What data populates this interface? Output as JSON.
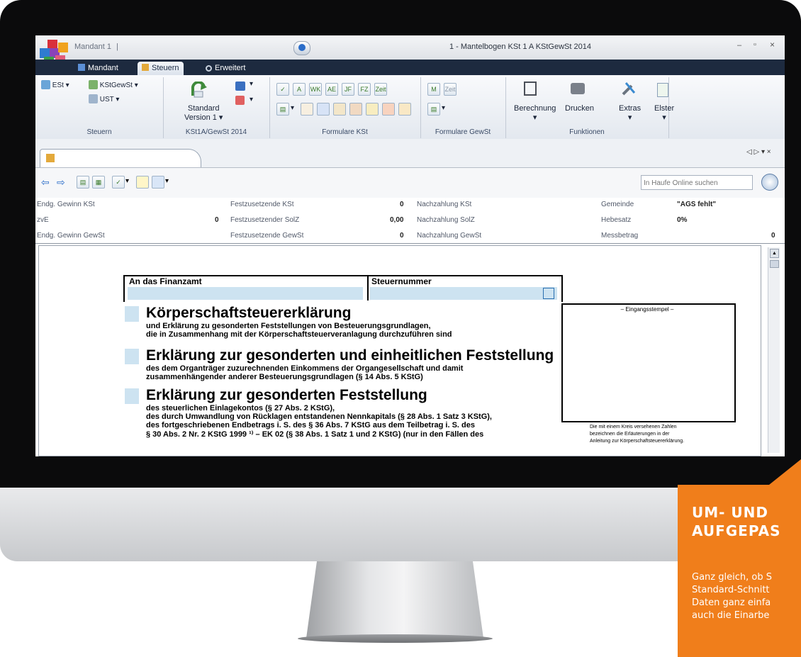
{
  "window": {
    "tab_label": "Mandant 1",
    "tab_separator": "|",
    "title": "1 - Mantelbogen KSt 1 A KStGewSt 2014",
    "controls": [
      "–",
      "▫",
      "×"
    ]
  },
  "menu": {
    "tabs": [
      "Mandant",
      "Steuern",
      "Erweitert"
    ]
  },
  "ribbon": {
    "steuern": {
      "est": "ESt",
      "kstgewst": "KStGewSt",
      "ust": "UST",
      "label": "Steuern"
    },
    "version": {
      "standard": "Standard",
      "version": "Version 1 ▾",
      "label": "KSt1A/GewSt 2014"
    },
    "formulare_kst": {
      "label": "Formulare KSt",
      "icons": [
        "A",
        "WK",
        "AE",
        "JF",
        "FZ",
        "Zeit"
      ]
    },
    "formulare_gewst": {
      "label": "Formulare GewSt",
      "icons": [
        "M",
        "Zeit"
      ]
    },
    "funktionen": {
      "berechnung": "Berechnung",
      "drucken": "Drucken",
      "extras": "Extras",
      "elster": "Elster",
      "label": "Funktionen"
    }
  },
  "doc_tabs": {
    "nav": "◁ ▷ ▾ ×"
  },
  "search": {
    "placeholder": "In Haufe Online suchen"
  },
  "summary": {
    "row1": {
      "l1": "Endg. Gewinn KSt",
      "l2": "Festzusetzende KSt",
      "v2": "0",
      "l3": "Nachzahlung KSt",
      "l4": "Gemeinde",
      "v4": "\"AGS fehlt\""
    },
    "row2": {
      "l1": "zvE",
      "v1": "0",
      "l2": "Festzusetzender SolZ",
      "v2": "0,00",
      "l3": "Nachzahlung SolZ",
      "l4": "Hebesatz",
      "v4": "0%"
    },
    "row3": {
      "l1": "Endg. Gewinn GewSt",
      "l2": "Festzusetzende GewSt",
      "v2": "0",
      "l3": "Nachzahlung GewSt",
      "l4": "Messbetrag",
      "v4": "0"
    }
  },
  "form": {
    "finanzamt": "An das Finanzamt",
    "steuernummer": "Steuernummer",
    "stamp": "– Eingangsstempel –",
    "section1": {
      "title": "Körperschaftsteuererklärung",
      "line1": "und Erklärung zu gesonderten Feststellungen von Besteuerungsgrundlagen,",
      "line2": "die in Zusammenhang mit der Körperschaftsteuerveranlagung durchzuführen sind"
    },
    "section2": {
      "title": "Erklärung zur gesonderten und einheitlichen Feststellung",
      "line1": "des dem Organträger zuzurechnenden Einkommens der Organgesellschaft und damit",
      "line2": "zusammenhängender anderer Besteuerungsgrundlagen (§ 14 Abs. 5 KStG)"
    },
    "section3": {
      "title": "Erklärung zur gesonderten Feststellung",
      "line1": "des steuerlichen Einlagekontos (§ 27 Abs. 2 KStG),",
      "line2": "des durch Umwandlung von Rücklagen entstandenen Nennkapitals (§ 28 Abs. 1 Satz 3 KStG),",
      "line3": "des fortgeschriebenen Endbetrags i. S. des § 36 Abs. 7 KStG aus dem Teilbetrag i. S. des",
      "line4": "§ 30 Abs. 2 Nr. 2 KStG 1999 ¹⁾ – EK 02 (§ 38 Abs. 1 Satz 1 und 2 KStG) (nur in den Fällen des"
    },
    "note": {
      "line1": "Die mit einem Kreis versehenen Zahlen",
      "line2": "bezeichnen die Erläuterungen in der",
      "line3": "Anleitung zur Körperschaftsteuererklärung."
    }
  },
  "promo": {
    "headline1": "UM- UND",
    "headline2": "AUFGEPAS",
    "body1": "Ganz gleich, ob S",
    "body2": "Standard-Schnitt",
    "body3": "Daten ganz einfa",
    "body4": "auch die Einarbe"
  },
  "colors": {
    "accent_orange": "#f07e1b",
    "menubar": "#1d2a3f",
    "field_blue": "#cde3f1"
  }
}
